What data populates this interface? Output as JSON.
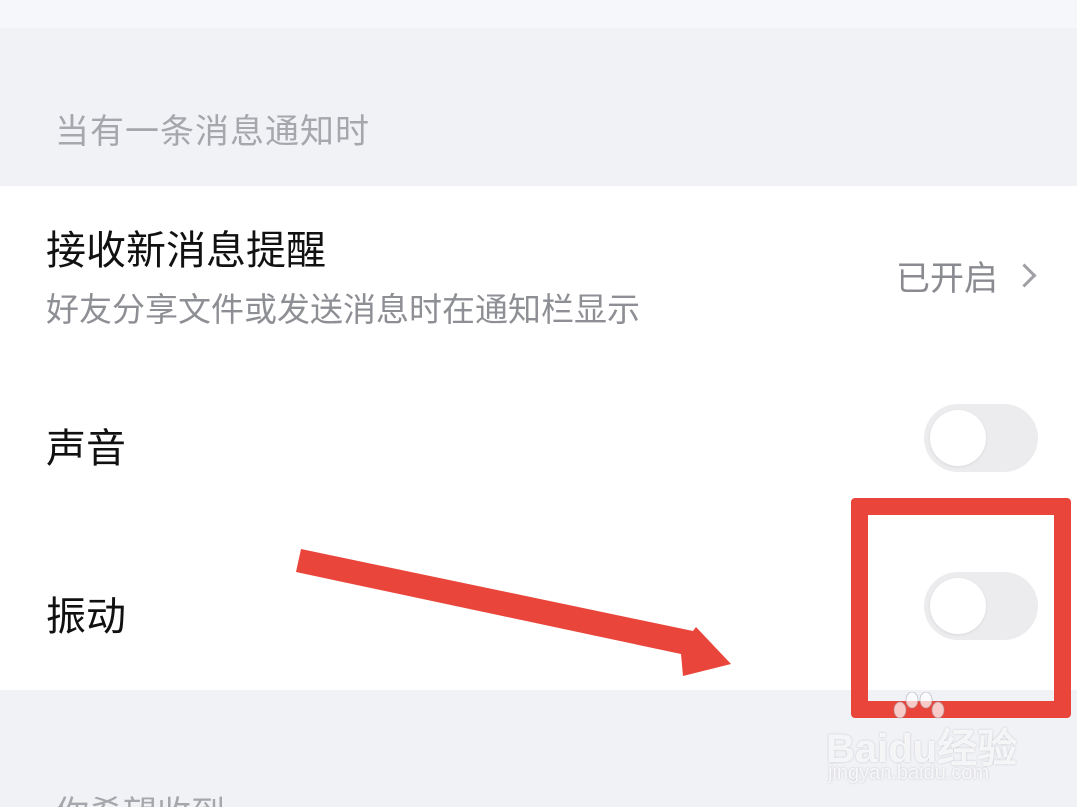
{
  "section_header": {
    "title": "当有一条消息通知时"
  },
  "settings": {
    "new_message_alert": {
      "title": "接收新消息提醒",
      "subtitle": "好友分享文件或发送消息时在通知栏显示",
      "status": "已开启"
    },
    "sound": {
      "title": "声音",
      "enabled": false
    },
    "vibration": {
      "title": "振动",
      "enabled": false
    }
  },
  "bottom_section": {
    "title": "你希望收到"
  },
  "annotations": {
    "arrow_color": "#e9453a",
    "highlight_color": "#e9453a"
  },
  "watermark": {
    "brand": "Baidu经验",
    "url": "jingyan.baidu.com"
  }
}
